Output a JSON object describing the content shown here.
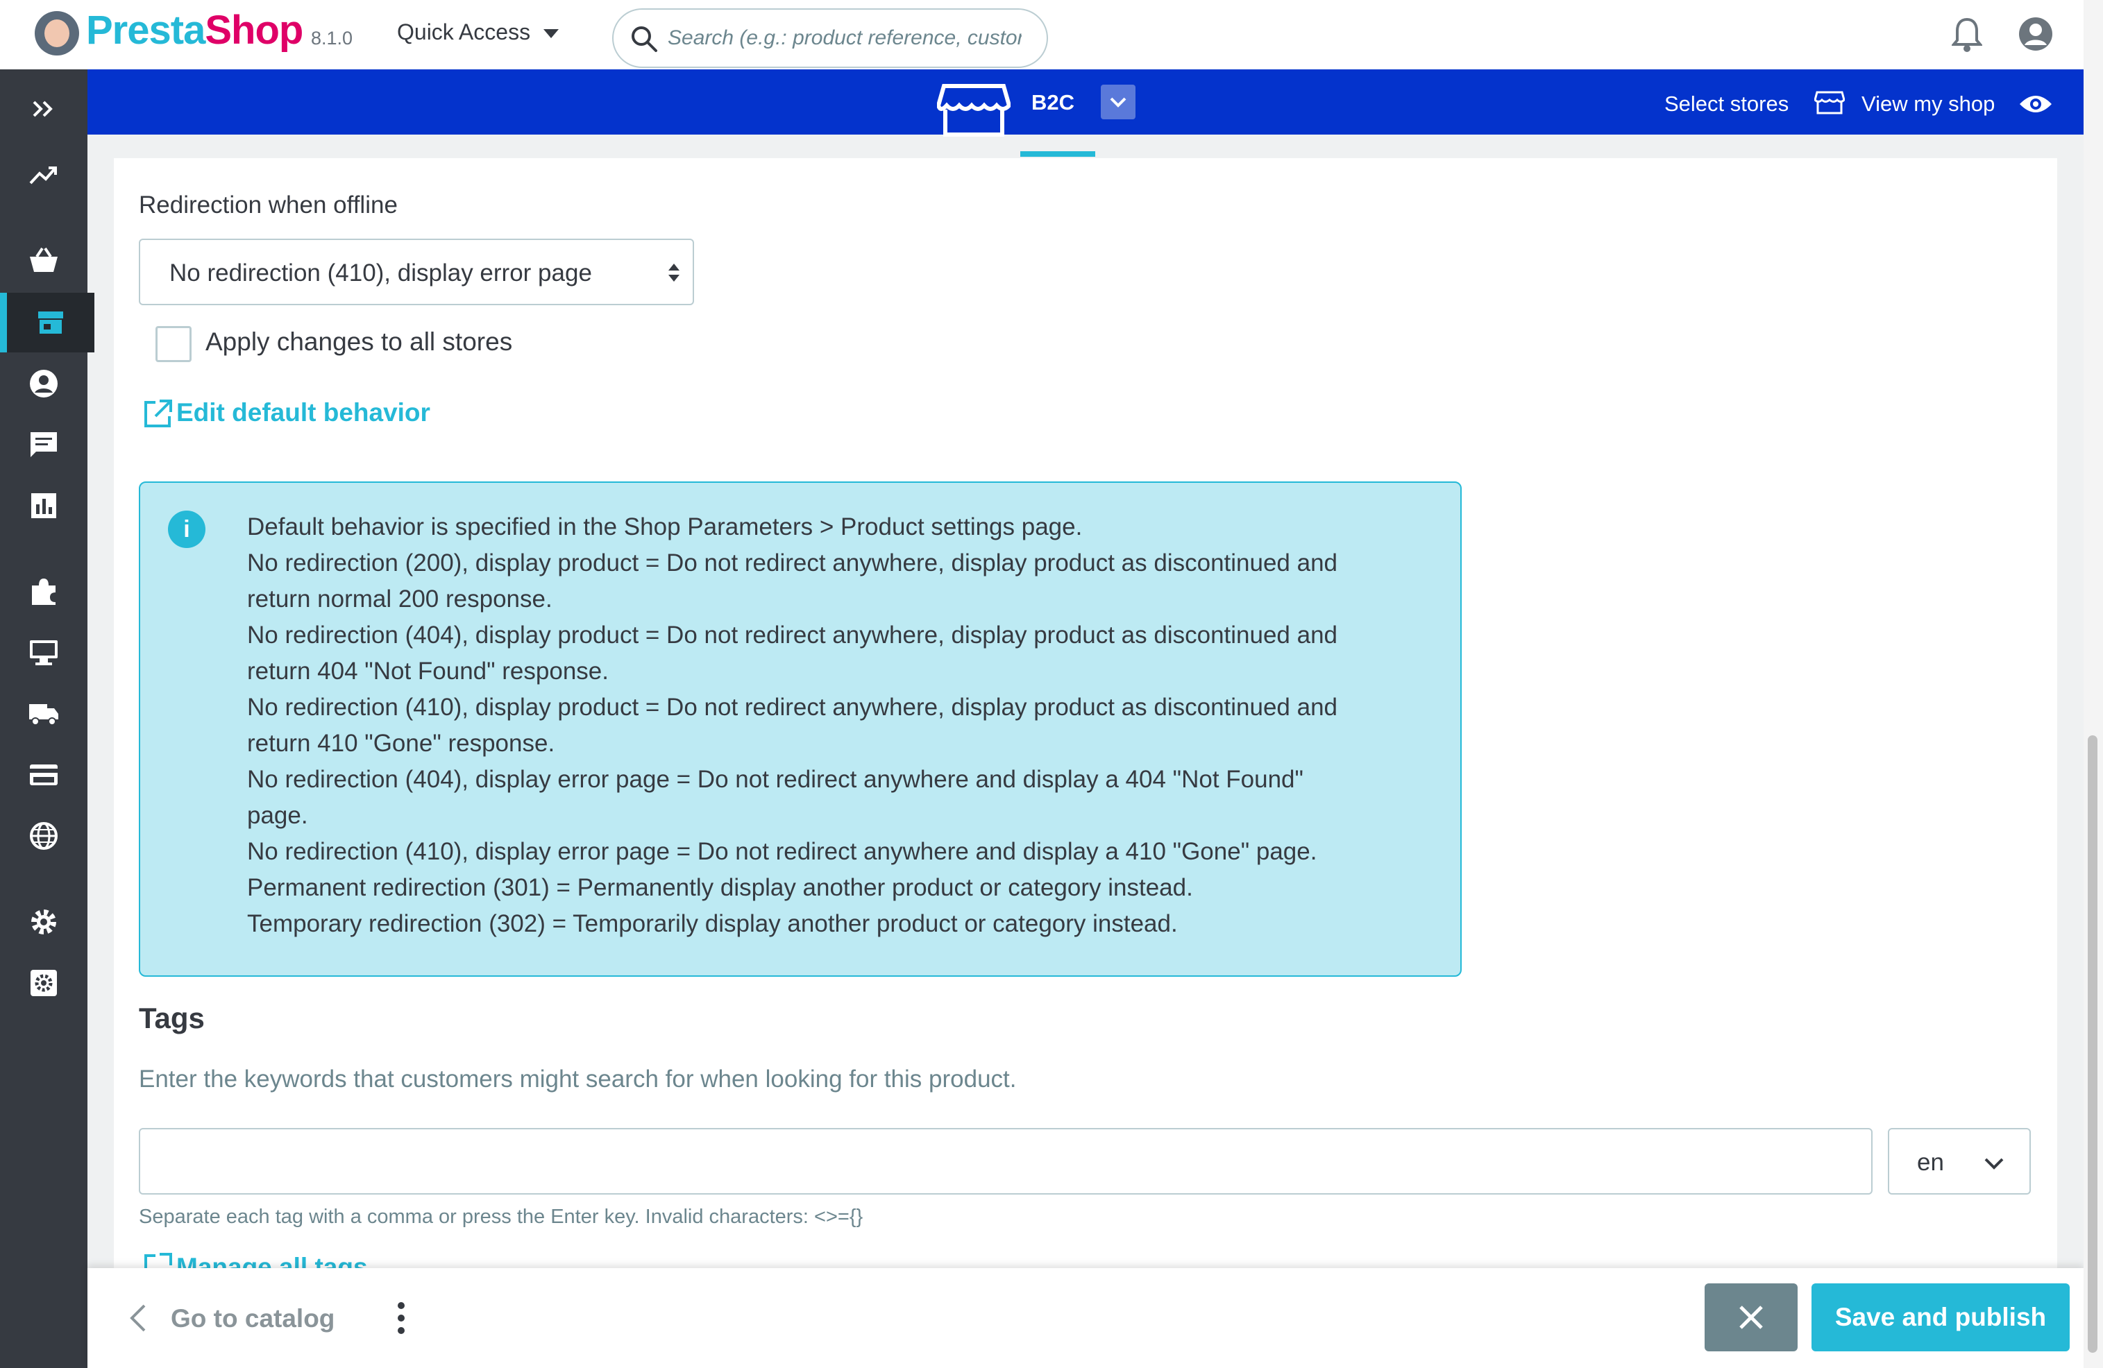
{
  "header": {
    "logo_text_a": "Presta",
    "logo_text_b": "Shop",
    "version": "8.1.0",
    "quick_access_label": "Quick Access",
    "search_placeholder": "Search (e.g.: product reference, custon"
  },
  "shopbar": {
    "store_name": "B2C",
    "select_stores_label": "Select stores",
    "view_shop_label": "View my shop"
  },
  "sidebar": {
    "items": [
      {
        "icon": "expand-icon"
      },
      {
        "icon": "trending-up-icon"
      },
      {
        "icon": "basket-icon"
      },
      {
        "icon": "store-icon",
        "active": true
      },
      {
        "icon": "customer-icon"
      },
      {
        "icon": "chat-icon"
      },
      {
        "icon": "stats-icon"
      },
      {
        "icon": "puzzle-icon"
      },
      {
        "icon": "monitor-icon"
      },
      {
        "icon": "truck-icon"
      },
      {
        "icon": "credit-card-icon"
      },
      {
        "icon": "globe-icon"
      },
      {
        "icon": "gear-icon"
      },
      {
        "icon": "advanced-gear-icon"
      }
    ]
  },
  "form": {
    "redirection_label": "Redirection when offline",
    "redirection_value": "No redirection (410), display error page",
    "apply_all_label": "Apply changes to all stores",
    "edit_default_label": "Edit default behavior",
    "info_lines": [
      "Default behavior is specified in the Shop Parameters > Product settings page.",
      "No redirection (200), display product = Do not redirect anywhere, display product as discontinued and",
      "return normal 200 response.",
      "No redirection (404), display product = Do not redirect anywhere, display product as discontinued and",
      "return 404 \"Not Found\" response.",
      "No redirection (410), display product = Do not redirect anywhere, display product as discontinued and",
      "return 410 \"Gone\" response.",
      "No redirection (404), display error page = Do not redirect anywhere and display a 404 \"Not Found\"",
      "page.",
      "No redirection (410), display error page = Do not redirect anywhere and display a 410 \"Gone\" page.",
      "Permanent redirection (301) = Permanently display another product or category instead.",
      "Temporary redirection (302) = Temporarily display another product or category instead."
    ],
    "tags_title": "Tags",
    "tags_help": "Enter the keywords that customers might search for when looking for this product.",
    "tags_value": "",
    "language": "en",
    "tags_note": "Separate each tag with a comma or press the Enter key. Invalid characters: <>={}",
    "manage_tags_label": "Manage all tags"
  },
  "footer": {
    "go_catalog_label": "Go to catalog",
    "save_label": "Save and publish"
  },
  "colors": {
    "accent": "#25b9d7",
    "shopbar": "#0433cc",
    "sidebar": "#363a41",
    "brand_pink": "#df0067"
  }
}
